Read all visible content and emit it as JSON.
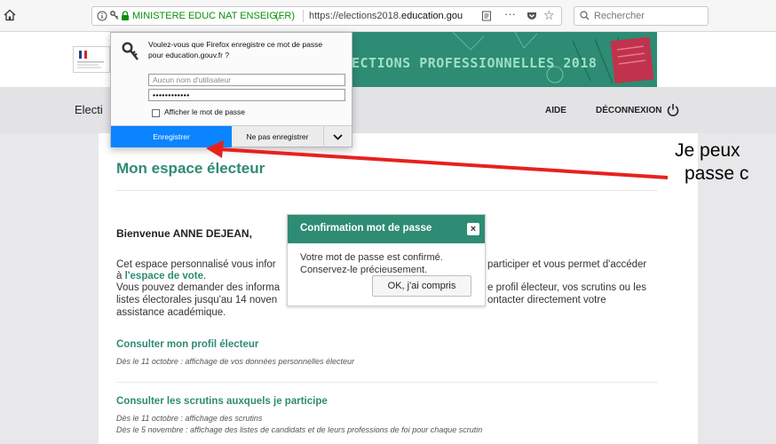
{
  "browser": {
    "site_identity": "MINISTERE EDUC NAT ENSEIG...",
    "site_country": "(FR)",
    "url_prefix": "https://elections2018.",
    "url_domain": "education.gou",
    "search_placeholder": "Rechercher"
  },
  "password_popup": {
    "question_line1": "Voulez-vous que Firefox enregistre ce mot de passe",
    "question_line2": "pour education.gouv.fr ?",
    "username_placeholder": "Aucun nom d'utilisateur",
    "password_mask": "••••••••••••",
    "show_password_label": "Afficher le mot de passe",
    "save_label": "Enregistrer",
    "dont_save_label": "Ne pas enregistrer"
  },
  "header": {
    "banner_title": "ECTIONS PROFESSIONNELLES 2018"
  },
  "navbar": {
    "brand": "Electi",
    "help": "AIDE",
    "logout": "DÉCONNEXION"
  },
  "main": {
    "title": "Mon espace électeur",
    "welcome": "Bienvenue ANNE DEJEAN,",
    "para_l1_left": "Cet espace personnalisé vous infor",
    "para_l1_right": "participer et vous permet d'accéder",
    "para_l2_prefix": "à ",
    "para_l2_link": "l'espace de vote",
    "para_l2_suffix": ".",
    "para_l3_left": "Vous pouvez demander des informa",
    "para_l3_right": "e profil électeur, vos scrutins ou les",
    "para_l4_left": "listes électorales jusqu'au 14 noven",
    "para_l4_right": "ontacter directement votre",
    "para_l5": "assistance académique.",
    "section1": {
      "title": "Consulter mon profil électeur",
      "note": "Dès le 11 octobre : affichage de vos données personnelles électeur"
    },
    "section2": {
      "title": "Consulter les scrutins auxquels je participe",
      "note1": "Dès le 11 octobre : affichage des scrutins",
      "note2": "Dès le 5 novembre : affichage des listes de candidats et de leurs professions de foi pour chaque scrutin"
    }
  },
  "modal": {
    "title": "Confirmation mot de passe",
    "close": "×",
    "text1": "Votre mot de passe est confirmé.",
    "text2": "Conservez-le précieusement.",
    "ok_label": "OK, j'ai compris"
  },
  "annotation": {
    "line1": "Je peux",
    "line2": "passe c",
    "color": "#e8211c"
  },
  "colors": {
    "brand_green": "#2e8b74",
    "firefox_blue": "#0a84ff"
  }
}
